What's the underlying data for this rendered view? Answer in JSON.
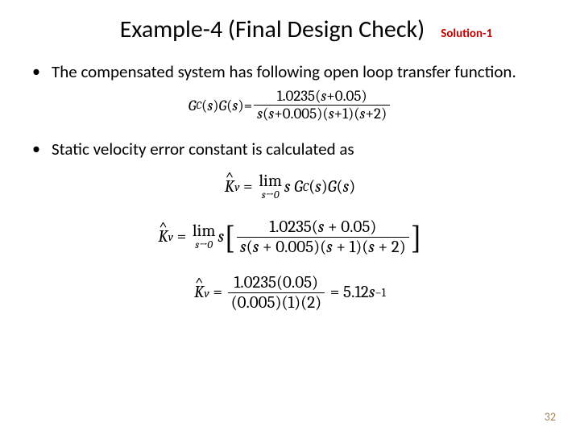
{
  "title": "Example-4 (Final Design Check)",
  "solution_tag": "Solution-1",
  "bullets": {
    "b1": "The compensated system has following open loop transfer function.",
    "b2": "Static velocity error constant is calculated as"
  },
  "eq1": {
    "lhs_Gc": "G",
    "lhs_Cc_sub": "C",
    "arg": "s",
    "lhs_G": "G",
    "num_coef": "1.0235",
    "num_zero": "0.05",
    "den_pole1": "0.005",
    "den_pole2": "1",
    "den_pole3": "2"
  },
  "eq2": {
    "K": "K",
    "v": "v",
    "lim": "lim",
    "limsub": "s→0",
    "s": "s",
    "Gc": "G",
    "C": "C",
    "G": "G"
  },
  "eq3": {
    "num_coef": "1.0235",
    "num_zero": "0.05",
    "den_pole1": "0.005",
    "den_pole2": "1",
    "den_pole3": "2"
  },
  "eq4": {
    "num_a": "1.0235",
    "num_b": "0.05",
    "den_a": "0.005",
    "den_b": "1",
    "den_c": "2",
    "result": "5.12",
    "unit_exp": "−1"
  },
  "pagenum": "32"
}
